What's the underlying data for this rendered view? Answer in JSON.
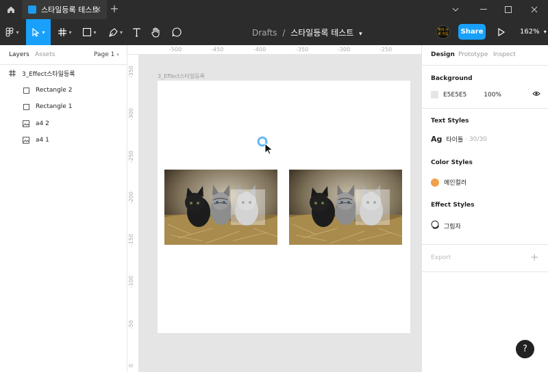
{
  "titlebar": {
    "tab_title": "스타일등록 테스트",
    "new_tab": "+",
    "close_tab": "✕"
  },
  "toolbar": {
    "breadcrumb_root": "Drafts",
    "breadcrumb_sep": "/",
    "file_name": "스타일등록 테스트",
    "share_label": "Share",
    "zoom_label": "162%",
    "avatar_text": "빛이 서로 이십"
  },
  "layers_panel": {
    "tab_layers": "Layers",
    "tab_assets": "Assets",
    "page_selector": "Page 1",
    "items": [
      {
        "label": "3_Effect스타일등록",
        "icon": "frame-icon"
      },
      {
        "label": "Rectangle 2",
        "icon": "rectangle-icon"
      },
      {
        "label": "Rectangle 1",
        "icon": "rectangle-icon"
      },
      {
        "label": "a4 2",
        "icon": "image-icon"
      },
      {
        "label": "a4 1",
        "icon": "image-icon"
      }
    ]
  },
  "rulers": {
    "top": [
      "-500",
      "-450",
      "-400",
      "-350",
      "-300",
      "-250"
    ],
    "left": [
      "-350",
      "-300",
      "-250",
      "-200",
      "-150",
      "-100",
      "-50",
      "0"
    ]
  },
  "canvas": {
    "frame_label": "3_Effect스타일등록",
    "frame_color": "#FFFFFF"
  },
  "design_panel": {
    "tab_design": "Design",
    "tab_prototype": "Prototype",
    "tab_inspect": "Inspect",
    "background_title": "Background",
    "background_hex": "E5E5E5",
    "background_opacity": "100%",
    "background_color": "#E5E5E5",
    "text_styles_title": "Text Styles",
    "text_style_glyph": "Ag",
    "text_style_name": "타이틀",
    "text_style_meta": "· 30/30",
    "color_styles_title": "Color Styles",
    "color_style_name": "메인컬러",
    "color_style_swatch": "#F0A04B",
    "effect_styles_title": "Effect Styles",
    "effect_style_name": "그림자",
    "export_title": "Export",
    "export_add": "+"
  },
  "help_label": "?"
}
